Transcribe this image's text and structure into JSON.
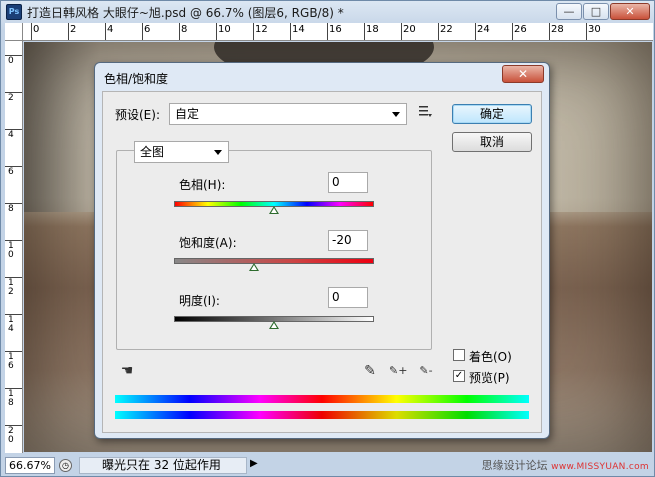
{
  "window": {
    "app_icon": "Ps",
    "title": "打造日韩风格 大眼仔~旭.psd @ 66.7% (图层6, RGB/8) *",
    "btn_min": "—",
    "btn_max": "□",
    "btn_close": "✕"
  },
  "ruler_top_labels": [
    "0",
    "2",
    "4",
    "6",
    "8",
    "10",
    "12",
    "14",
    "16",
    "18",
    "20",
    "22",
    "24",
    "26",
    "28",
    "30"
  ],
  "ruler_left_labels": [
    "0",
    "2",
    "4",
    "6",
    "8",
    "10",
    "12",
    "14",
    "16",
    "18",
    "20"
  ],
  "status": {
    "zoom": "66.67%",
    "info": "曝光只在 32 位起作用",
    "arrow": "▶"
  },
  "watermark": {
    "site": "思缘设计论坛",
    "url": "www.MISSYUAN.com"
  },
  "dialog": {
    "title": "色相/饱和度",
    "close": "✕",
    "preset_label": "预设(E):",
    "preset_value": "自定",
    "preset_menu_icon": "list-menu-icon",
    "ok": "确定",
    "cancel": "取消",
    "edit_value": "全图",
    "hue_label": "色相(H):",
    "hue_value": "0",
    "saturation_label": "饱和度(A):",
    "saturation_value": "-20",
    "lightness_label": "明度(I):",
    "lightness_value": "0",
    "colorize_label": "着色(O)",
    "colorize_checked": false,
    "preview_label": "预览(P)",
    "preview_checked": true,
    "check_mark": "✓",
    "hand_tool_glyph": "☚",
    "eyedropper_glyph": "✎",
    "eyedropper_plus_glyph": "✎+",
    "eyedropper_minus_glyph": "✎-"
  },
  "slider_levels": {
    "hue": 0.5,
    "saturation": 0.4,
    "lightness": 0.5
  }
}
